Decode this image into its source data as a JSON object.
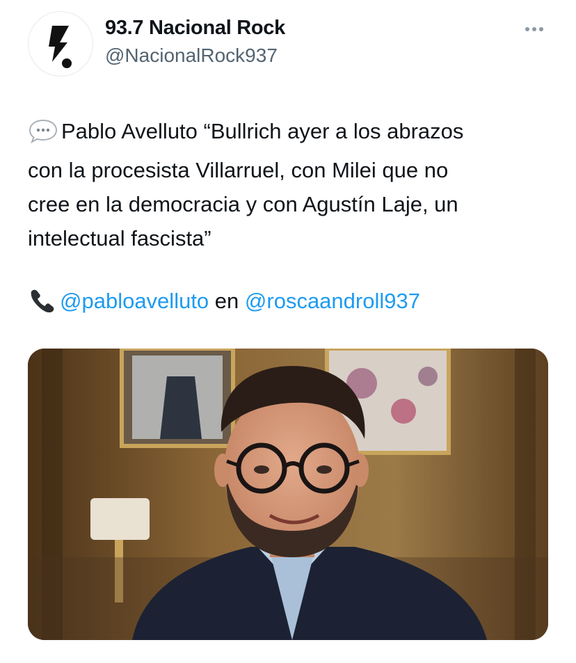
{
  "account": {
    "display_name": "93.7 Nacional Rock",
    "handle": "@NacionalRock937"
  },
  "tweet": {
    "text": "Pablo Avelluto “Bullrich ayer a los abrazos con la procesista Villarruel, con Milei que no cree en la democracia y con Agustín Laje, un intelectual fascista”",
    "text_lines": [
      "Pablo Avelluto “Bullrich ayer a los abrazos",
      "con la procesista Villarruel, con Milei que no",
      "cree en la democracia y con Agustín Laje, un",
      "intelectual fascista”"
    ],
    "mention_1": "@pabloavelluto",
    "connector": "en",
    "mention_2": "@roscaandroll937"
  },
  "icons": {
    "avatar": "lightning-bolt-logo",
    "more": "more-horizontal-icon",
    "speech": "speech-balloon-emoji",
    "phone": "telephone-receiver-emoji"
  },
  "colors": {
    "link": "#1d9bf0",
    "text": "#0f1419",
    "secondary": "#536471"
  }
}
